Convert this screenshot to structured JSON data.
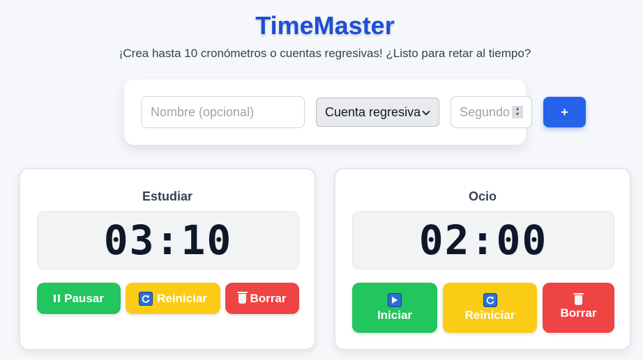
{
  "app": {
    "title": "TimeMaster",
    "subtitle": "¡Crea hasta 10 cronómetros o cuentas regresivas! ¿Listo para retar al tiempo?"
  },
  "form": {
    "name_placeholder": "Nombre (opcional)",
    "mode_selected": "Cuenta regresiva",
    "seconds_placeholder": "Segundos",
    "add_label": "+"
  },
  "timers": [
    {
      "name": "Estudiar",
      "time": "03:10",
      "buttons": {
        "primary": "Pausar",
        "reset": "Reiniciar",
        "delete": "Borrar"
      }
    },
    {
      "name": "Ocio",
      "time": "02:00",
      "buttons": {
        "primary": "Iniciar",
        "reset": "Reiniciar",
        "delete": "Borrar"
      }
    }
  ],
  "colors": {
    "accent": "#1d4ed8",
    "add_button": "#2563eb",
    "start_pause": "#22c55e",
    "reset": "#facc15",
    "delete": "#ef4444"
  },
  "icons": {
    "pause": "pause-icon",
    "play": "play-icon",
    "reset": "refresh-icon",
    "delete": "trash-icon",
    "select": "chevron-down-icon",
    "spinner": "number-spinner-icon"
  }
}
